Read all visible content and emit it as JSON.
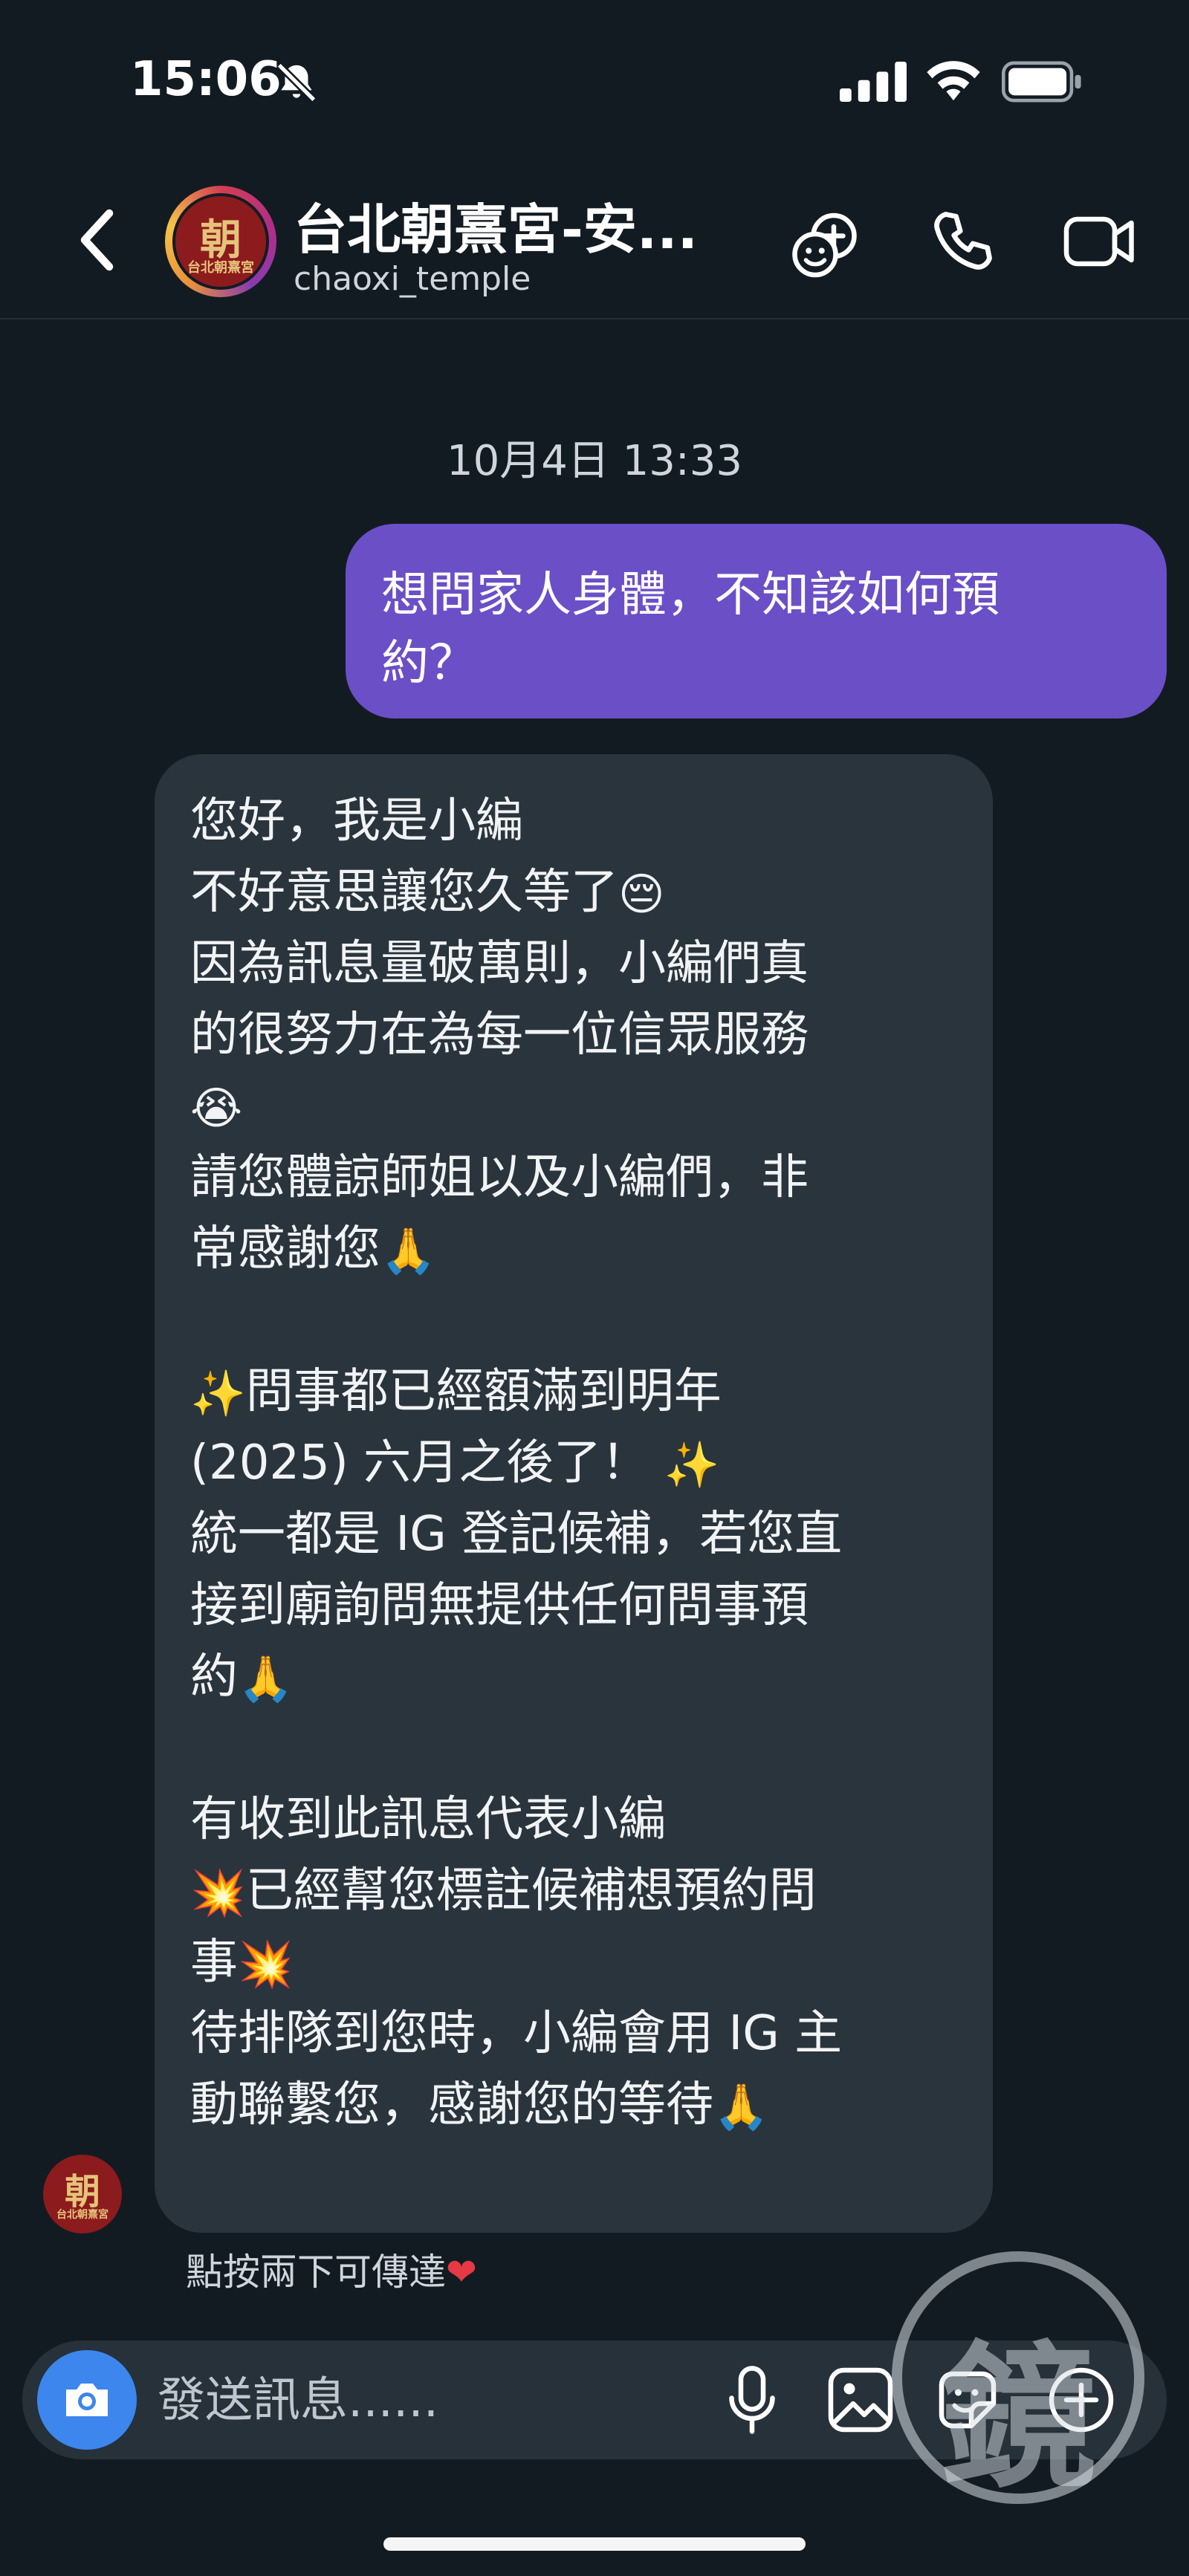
{
  "status_bar": {
    "time": "15:06"
  },
  "header": {
    "contact_name": "台北朝熹宮-安...",
    "contact_handle": "chaoxi_temple",
    "avatar_logo_text": "朝",
    "avatar_caption": "台北朝熹宮"
  },
  "thread": {
    "timestamp": "10月4日 13:33",
    "sent_message": {
      "line1": "想問家人身體，不知該如何預",
      "line2": "約？"
    },
    "received_message": {
      "lines": [
        {
          "text": "您好，我是小編",
          "pre": "",
          "post": ""
        },
        {
          "text": "不好意思讓您久等了",
          "pre": "",
          "post": "😔"
        },
        {
          "text": "因為訊息量破萬則，小編們真",
          "pre": "",
          "post": ""
        },
        {
          "text": "的很努力在為每一位信眾服務",
          "pre": "",
          "post": ""
        },
        {
          "text": "",
          "pre": "",
          "post": "😭"
        },
        {
          "text": "請您體諒師姐以及小編們，非",
          "pre": "",
          "post": ""
        },
        {
          "text": "常感謝您",
          "pre": "",
          "post": "🙏"
        },
        {
          "text": "",
          "pre": "",
          "post": ""
        },
        {
          "text": "問事都已經額滿到明年",
          "pre": "✨",
          "post": ""
        },
        {
          "text": "(2025) 六月之後了！ ",
          "pre": "",
          "post": "✨"
        },
        {
          "text": "統一都是 IG 登記候補，若您直",
          "pre": "",
          "post": ""
        },
        {
          "text": "接到廟詢問無提供任何問事預",
          "pre": "",
          "post": ""
        },
        {
          "text": "約",
          "pre": "",
          "post": "🙏"
        },
        {
          "text": "",
          "pre": "",
          "post": ""
        },
        {
          "text": "有收到此訊息代表小編",
          "pre": "",
          "post": ""
        },
        {
          "text": "已經幫您標註候補想預約問",
          "pre": "💥",
          "post": ""
        },
        {
          "text": "事",
          "pre": "",
          "post": "💥"
        },
        {
          "text": "待排隊到您時，小編會用 IG 主",
          "pre": "",
          "post": ""
        },
        {
          "text": "動聯繫您，感謝您的等待",
          "pre": "",
          "post": "🙏"
        }
      ]
    },
    "reaction_hint": "點按兩下可傳達",
    "reaction_heart": "❤"
  },
  "composer": {
    "placeholder": "發送訊息......"
  },
  "watermark": {
    "text": "鏡"
  },
  "colors": {
    "background": "#131b22",
    "sent_bubble": "#6b4fc7",
    "received_bubble": "#2a343d",
    "camera_button": "#3c86ee"
  },
  "icons": [
    "bell-slash-icon",
    "signal-icon",
    "wifi-icon",
    "battery-icon",
    "back-icon",
    "add-user-icon",
    "phone-icon",
    "video-icon",
    "camera-icon",
    "mic-icon",
    "gallery-icon",
    "sticker-icon",
    "plus-icon"
  ]
}
